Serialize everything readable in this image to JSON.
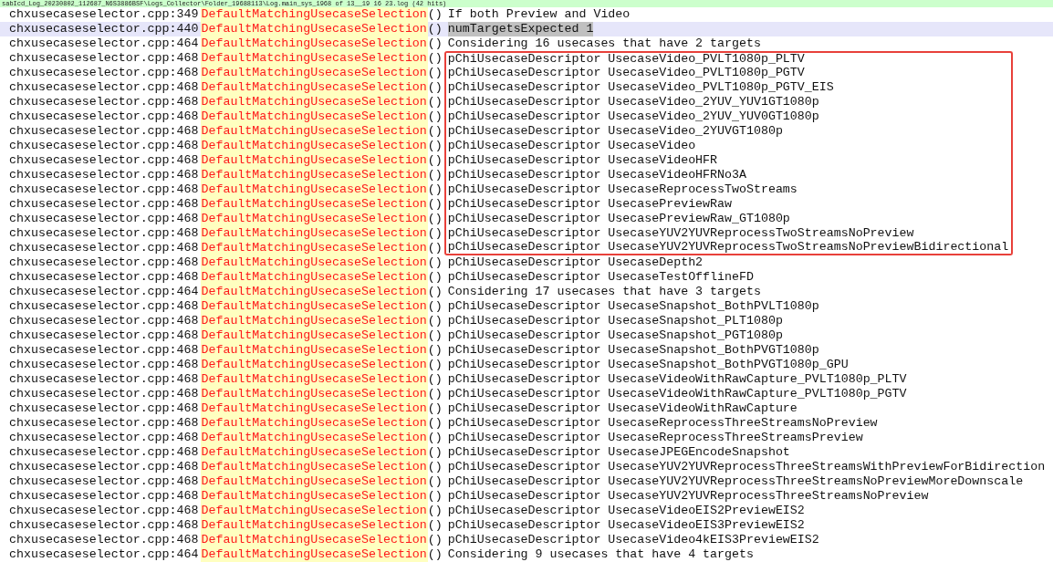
{
  "header": {
    "text": "sabIcd_Log_20230802_112687_N6S3886BSF\\Logs_Collector\\Folder_19688113\\Log.main_sys_1968 of 13__19 16 23.log (42 hits)"
  },
  "rows": [
    {
      "file": "chxusecaseselector.cpp:349",
      "func": "DefaultMatchingUsecaseSelection",
      "args": "()",
      "msg": "If both Preview and Video",
      "selected": false,
      "boxed": false
    },
    {
      "file": "chxusecaseselector.cpp:440",
      "func": "DefaultMatchingUsecaseSelection",
      "args": "()",
      "msg": "numTargetsExpected 1",
      "selected": true,
      "boxed": false
    },
    {
      "file": "chxusecaseselector.cpp:464",
      "func": "DefaultMatchingUsecaseSelection",
      "args": "()",
      "msg": "Considering 16 usecases that have 2 targets",
      "selected": false,
      "boxed": false
    },
    {
      "file": "chxusecaseselector.cpp:468",
      "func": "DefaultMatchingUsecaseSelection",
      "args": "()",
      "msg": "pChiUsecaseDescriptor UsecaseVideo_PVLT1080p_PLTV",
      "selected": false,
      "boxed": true
    },
    {
      "file": "chxusecaseselector.cpp:468",
      "func": "DefaultMatchingUsecaseSelection",
      "args": "()",
      "msg": "pChiUsecaseDescriptor UsecaseVideo_PVLT1080p_PGTV",
      "selected": false,
      "boxed": true
    },
    {
      "file": "chxusecaseselector.cpp:468",
      "func": "DefaultMatchingUsecaseSelection",
      "args": "()",
      "msg": "pChiUsecaseDescriptor UsecaseVideo_PVLT1080p_PGTV_EIS",
      "selected": false,
      "boxed": true
    },
    {
      "file": "chxusecaseselector.cpp:468",
      "func": "DefaultMatchingUsecaseSelection",
      "args": "()",
      "msg": "pChiUsecaseDescriptor UsecaseVideo_2YUV_YUV1GT1080p",
      "selected": false,
      "boxed": true
    },
    {
      "file": "chxusecaseselector.cpp:468",
      "func": "DefaultMatchingUsecaseSelection",
      "args": "()",
      "msg": "pChiUsecaseDescriptor UsecaseVideo_2YUV_YUV0GT1080p",
      "selected": false,
      "boxed": true
    },
    {
      "file": "chxusecaseselector.cpp:468",
      "func": "DefaultMatchingUsecaseSelection",
      "args": "()",
      "msg": "pChiUsecaseDescriptor UsecaseVideo_2YUVGT1080p",
      "selected": false,
      "boxed": true
    },
    {
      "file": "chxusecaseselector.cpp:468",
      "func": "DefaultMatchingUsecaseSelection",
      "args": "()",
      "msg": "pChiUsecaseDescriptor UsecaseVideo",
      "selected": false,
      "boxed": true
    },
    {
      "file": "chxusecaseselector.cpp:468",
      "func": "DefaultMatchingUsecaseSelection",
      "args": "()",
      "msg": "pChiUsecaseDescriptor UsecaseVideoHFR",
      "selected": false,
      "boxed": true
    },
    {
      "file": "chxusecaseselector.cpp:468",
      "func": "DefaultMatchingUsecaseSelection",
      "args": "()",
      "msg": "pChiUsecaseDescriptor UsecaseVideoHFRNo3A",
      "selected": false,
      "boxed": true
    },
    {
      "file": "chxusecaseselector.cpp:468",
      "func": "DefaultMatchingUsecaseSelection",
      "args": "()",
      "msg": "pChiUsecaseDescriptor UsecaseReprocessTwoStreams",
      "selected": false,
      "boxed": true
    },
    {
      "file": "chxusecaseselector.cpp:468",
      "func": "DefaultMatchingUsecaseSelection",
      "args": "()",
      "msg": "pChiUsecaseDescriptor UsecasePreviewRaw",
      "selected": false,
      "boxed": true
    },
    {
      "file": "chxusecaseselector.cpp:468",
      "func": "DefaultMatchingUsecaseSelection",
      "args": "()",
      "msg": "pChiUsecaseDescriptor UsecasePreviewRaw_GT1080p",
      "selected": false,
      "boxed": true
    },
    {
      "file": "chxusecaseselector.cpp:468",
      "func": "DefaultMatchingUsecaseSelection",
      "args": "()",
      "msg": "pChiUsecaseDescriptor UsecaseYUV2YUVReprocessTwoStreamsNoPreview",
      "selected": false,
      "boxed": true
    },
    {
      "file": "chxusecaseselector.cpp:468",
      "func": "DefaultMatchingUsecaseSelection",
      "args": "()",
      "msg": "pChiUsecaseDescriptor UsecaseYUV2YUVReprocessTwoStreamsNoPreviewBidirectional",
      "selected": false,
      "boxed": true
    },
    {
      "file": "chxusecaseselector.cpp:468",
      "func": "DefaultMatchingUsecaseSelection",
      "args": "()",
      "msg": "pChiUsecaseDescriptor UsecaseDepth2",
      "selected": false,
      "boxed": false
    },
    {
      "file": "chxusecaseselector.cpp:468",
      "func": "DefaultMatchingUsecaseSelection",
      "args": "()",
      "msg": "pChiUsecaseDescriptor UsecaseTestOfflineFD",
      "selected": false,
      "boxed": false
    },
    {
      "file": "chxusecaseselector.cpp:464",
      "func": "DefaultMatchingUsecaseSelection",
      "args": "()",
      "msg": "Considering 17 usecases that have 3 targets",
      "selected": false,
      "boxed": false
    },
    {
      "file": "chxusecaseselector.cpp:468",
      "func": "DefaultMatchingUsecaseSelection",
      "args": "()",
      "msg": "pChiUsecaseDescriptor UsecaseSnapshot_BothPVLT1080p",
      "selected": false,
      "boxed": false
    },
    {
      "file": "chxusecaseselector.cpp:468",
      "func": "DefaultMatchingUsecaseSelection",
      "args": "()",
      "msg": "pChiUsecaseDescriptor UsecaseSnapshot_PLT1080p",
      "selected": false,
      "boxed": false
    },
    {
      "file": "chxusecaseselector.cpp:468",
      "func": "DefaultMatchingUsecaseSelection",
      "args": "()",
      "msg": "pChiUsecaseDescriptor UsecaseSnapshot_PGT1080p",
      "selected": false,
      "boxed": false
    },
    {
      "file": "chxusecaseselector.cpp:468",
      "func": "DefaultMatchingUsecaseSelection",
      "args": "()",
      "msg": "pChiUsecaseDescriptor UsecaseSnapshot_BothPVGT1080p",
      "selected": false,
      "boxed": false
    },
    {
      "file": "chxusecaseselector.cpp:468",
      "func": "DefaultMatchingUsecaseSelection",
      "args": "()",
      "msg": "pChiUsecaseDescriptor UsecaseSnapshot_BothPVGT1080p_GPU",
      "selected": false,
      "boxed": false
    },
    {
      "file": "chxusecaseselector.cpp:468",
      "func": "DefaultMatchingUsecaseSelection",
      "args": "()",
      "msg": "pChiUsecaseDescriptor UsecaseVideoWithRawCapture_PVLT1080p_PLTV",
      "selected": false,
      "boxed": false
    },
    {
      "file": "chxusecaseselector.cpp:468",
      "func": "DefaultMatchingUsecaseSelection",
      "args": "()",
      "msg": "pChiUsecaseDescriptor UsecaseVideoWithRawCapture_PVLT1080p_PGTV",
      "selected": false,
      "boxed": false
    },
    {
      "file": "chxusecaseselector.cpp:468",
      "func": "DefaultMatchingUsecaseSelection",
      "args": "()",
      "msg": "pChiUsecaseDescriptor UsecaseVideoWithRawCapture",
      "selected": false,
      "boxed": false
    },
    {
      "file": "chxusecaseselector.cpp:468",
      "func": "DefaultMatchingUsecaseSelection",
      "args": "()",
      "msg": "pChiUsecaseDescriptor UsecaseReprocessThreeStreamsNoPreview",
      "selected": false,
      "boxed": false
    },
    {
      "file": "chxusecaseselector.cpp:468",
      "func": "DefaultMatchingUsecaseSelection",
      "args": "()",
      "msg": "pChiUsecaseDescriptor UsecaseReprocessThreeStreamsPreview",
      "selected": false,
      "boxed": false
    },
    {
      "file": "chxusecaseselector.cpp:468",
      "func": "DefaultMatchingUsecaseSelection",
      "args": "()",
      "msg": "pChiUsecaseDescriptor UsecaseJPEGEncodeSnapshot",
      "selected": false,
      "boxed": false
    },
    {
      "file": "chxusecaseselector.cpp:468",
      "func": "DefaultMatchingUsecaseSelection",
      "args": "()",
      "msg": "pChiUsecaseDescriptor UsecaseYUV2YUVReprocessThreeStreamsWithPreviewForBidirection",
      "selected": false,
      "boxed": false
    },
    {
      "file": "chxusecaseselector.cpp:468",
      "func": "DefaultMatchingUsecaseSelection",
      "args": "()",
      "msg": "pChiUsecaseDescriptor UsecaseYUV2YUVReprocessThreeStreamsNoPreviewMoreDownscale",
      "selected": false,
      "boxed": false
    },
    {
      "file": "chxusecaseselector.cpp:468",
      "func": "DefaultMatchingUsecaseSelection",
      "args": "()",
      "msg": "pChiUsecaseDescriptor UsecaseYUV2YUVReprocessThreeStreamsNoPreview",
      "selected": false,
      "boxed": false
    },
    {
      "file": "chxusecaseselector.cpp:468",
      "func": "DefaultMatchingUsecaseSelection",
      "args": "()",
      "msg": "pChiUsecaseDescriptor UsecaseVideoEIS2PreviewEIS2",
      "selected": false,
      "boxed": false
    },
    {
      "file": "chxusecaseselector.cpp:468",
      "func": "DefaultMatchingUsecaseSelection",
      "args": "()",
      "msg": "pChiUsecaseDescriptor UsecaseVideoEIS3PreviewEIS2",
      "selected": false,
      "boxed": false
    },
    {
      "file": "chxusecaseselector.cpp:468",
      "func": "DefaultMatchingUsecaseSelection",
      "args": "()",
      "msg": "pChiUsecaseDescriptor UsecaseVideo4kEIS3PreviewEIS2",
      "selected": false,
      "boxed": false
    },
    {
      "file": "chxusecaseselector.cpp:464",
      "func": "DefaultMatchingUsecaseSelection",
      "args": "()",
      "msg": "Considering 9 usecases that have 4 targets",
      "selected": false,
      "boxed": false
    }
  ]
}
